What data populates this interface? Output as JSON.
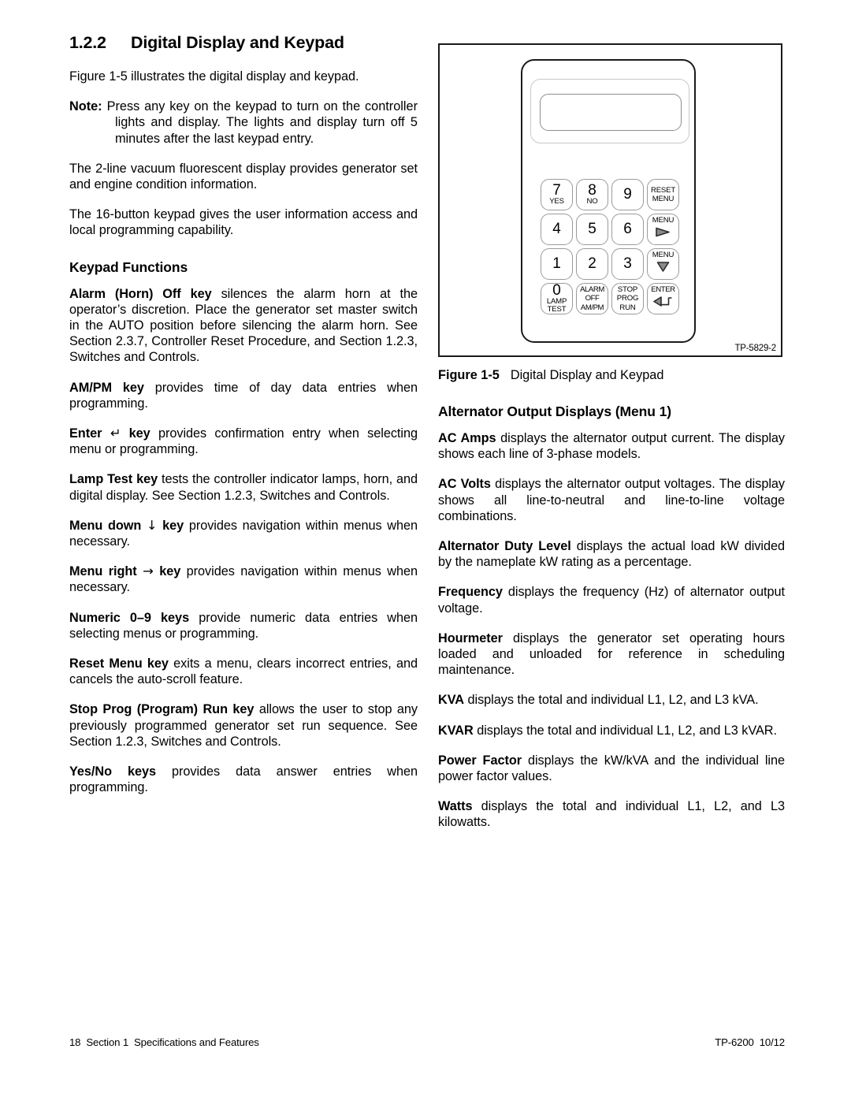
{
  "section": {
    "number": "1.2.2",
    "title": "Digital Display and Keypad"
  },
  "left_column": {
    "intro": "Figure 1-5 illustrates the digital display and keypad.",
    "note": {
      "label": "Note:",
      "text": "Press any key on the keypad to turn on the controller lights and display.  The lights and display turn off 5 minutes after the last keypad entry."
    },
    "para_display": "The 2-line vacuum fluorescent display provides generator set and engine condition information.",
    "para_keypad": "The 16-button keypad gives the user information access and local programming capability.",
    "keypad_functions_heading": "Keypad Functions",
    "functions": [
      {
        "term": "Alarm (Horn) Off key",
        "glyph": "",
        "text": " silences the alarm horn at the operator’s discretion.  Place the generator set master switch in the AUTO position before silencing the alarm horn.  See Section 2.3.7, Controller Reset Procedure, and Section 1.2.3, Switches and Controls."
      },
      {
        "term": "AM/PM key",
        "glyph": "",
        "text": " provides time of day data entries when programming."
      },
      {
        "term_pre": "Enter",
        "glyph": "↵",
        "term_post": "key",
        "text": " provides confirmation entry when selecting menu or programming."
      },
      {
        "term": "Lamp Test key",
        "glyph": "",
        "text": " tests the controller indicator lamps, horn, and digital display.  See Section 1.2.3, Switches and Controls."
      },
      {
        "term_pre": "Menu down",
        "glyph": "↓",
        "term_post": "key",
        "text": " provides navigation within menus when necessary."
      },
      {
        "term_pre": "Menu right",
        "glyph": "→",
        "term_post": "key",
        "text": " provides navigation within menus when necessary."
      },
      {
        "term": "Numeric 0–9 keys",
        "glyph": "",
        "text": " provide numeric data entries when selecting menus or programming."
      },
      {
        "term": "Reset Menu key",
        "glyph": "",
        "text": " exits a menu, clears incorrect entries, and cancels the auto-scroll feature."
      },
      {
        "term": "Stop Prog (Program) Run key",
        "glyph": "",
        "text": " allows the user to stop any previously programmed generator set run sequence.  See Section 1.2.3, Switches and Controls."
      },
      {
        "term": "Yes/No keys",
        "glyph": "",
        "text": " provides data answer entries when programming."
      }
    ]
  },
  "figure": {
    "tp_code": "TP-5829-2",
    "caption_label": "Figure 1-5",
    "caption_text": "Digital Display and Keypad",
    "keypad": {
      "keys": [
        {
          "big": "7",
          "small": [
            "YES"
          ],
          "name": "key-7-yes"
        },
        {
          "big": "8",
          "small": [
            "NO"
          ],
          "name": "key-8-no"
        },
        {
          "big": "9",
          "small": [],
          "name": "key-9"
        },
        {
          "big": "",
          "small": [
            "RESET",
            "MENU"
          ],
          "name": "key-reset-menu"
        },
        {
          "big": "4",
          "small": [],
          "name": "key-4"
        },
        {
          "big": "5",
          "small": [],
          "name": "key-5"
        },
        {
          "big": "6",
          "small": [],
          "name": "key-6"
        },
        {
          "big": "",
          "small": [
            "MENU"
          ],
          "arrow": "right",
          "name": "key-menu-right"
        },
        {
          "big": "1",
          "small": [],
          "name": "key-1"
        },
        {
          "big": "2",
          "small": [],
          "name": "key-2"
        },
        {
          "big": "3",
          "small": [],
          "name": "key-3"
        },
        {
          "big": "",
          "small": [
            "MENU"
          ],
          "arrow": "down",
          "name": "key-menu-down"
        },
        {
          "big": "0",
          "small": [
            "LAMP",
            "TEST"
          ],
          "name": "key-0-lamp-test"
        },
        {
          "big": "",
          "small": [
            "ALARM",
            "OFF",
            "AM/PM"
          ],
          "name": "key-alarm-off-ampm"
        },
        {
          "big": "",
          "small": [
            "STOP",
            "PROG",
            "RUN"
          ],
          "name": "key-stop-prog-run"
        },
        {
          "big": "",
          "small": [
            "ENTER"
          ],
          "arrow": "enter",
          "name": "key-enter"
        }
      ]
    }
  },
  "right_column": {
    "heading": "Alternator Output Displays (Menu 1)",
    "items": [
      {
        "term": "AC Amps",
        "text": " displays the alternator output current.  The display shows each line of 3-phase models."
      },
      {
        "term": "AC Volts",
        "text": " displays the alternator output voltages.  The display shows all line-to-neutral and line-to-line voltage combinations."
      },
      {
        "term": "Alternator Duty Level",
        "text": " displays the actual load kW divided by the nameplate kW rating as a percentage."
      },
      {
        "term": "Frequency",
        "text": " displays the frequency (Hz) of alternator output voltage."
      },
      {
        "term": "Hourmeter",
        "text": " displays the generator set operating hours loaded and unloaded for reference in scheduling maintenance."
      },
      {
        "term": "KVA",
        "text": " displays the total and individual L1, L2, and L3 kVA."
      },
      {
        "term": "KVAR",
        "text": " displays the total and individual L1, L2, and L3 kVAR."
      },
      {
        "term": "Power Factor",
        "text": " displays the kW/kVA and the individual line power factor values."
      },
      {
        "term": "Watts",
        "text": " displays the total and individual L1, L2, and L3 kilowatts."
      }
    ]
  },
  "footer": {
    "page_number": "18",
    "section_label": "Section 1",
    "section_name": "Specifications and Features",
    "doc_code": "TP-6200",
    "doc_date": "10/12"
  }
}
